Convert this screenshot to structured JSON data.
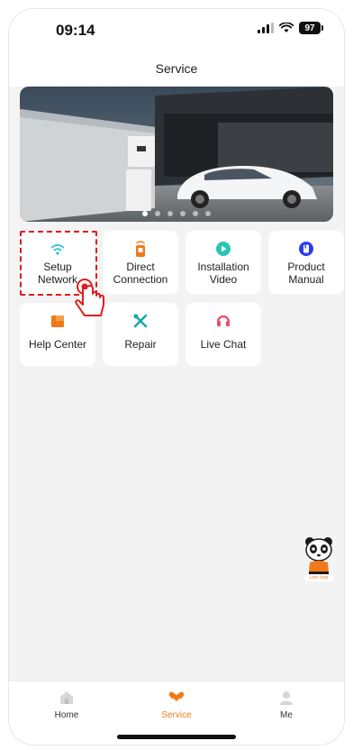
{
  "status_bar": {
    "time": "09:14",
    "battery": "97"
  },
  "header": {
    "title": "Service"
  },
  "banner": {
    "slide_count": 6,
    "active_index": 0
  },
  "services": [
    {
      "label": "Setup\nNetwork",
      "icon": "wifi-icon",
      "color": "#1fc1c9"
    },
    {
      "label": "Direct\nConnection",
      "icon": "direct-connection-icon",
      "color": "#f07a1a"
    },
    {
      "label": "Installation\nVideo",
      "icon": "play-icon",
      "color": "#2cc5b4"
    },
    {
      "label": "Product\nManual",
      "icon": "manual-icon",
      "color": "#2b3cf0"
    },
    {
      "label": "Help Center",
      "icon": "help-center-icon",
      "color": "#f07a1a"
    },
    {
      "label": "Repair",
      "icon": "repair-icon",
      "color": "#17a8a8"
    },
    {
      "label": "Live Chat",
      "icon": "headset-icon",
      "color": "#f2456a"
    }
  ],
  "mascot": {
    "badge": "Live chat"
  },
  "tabbar": {
    "tabs": [
      {
        "label": "Home",
        "icon": "home-icon",
        "active": false
      },
      {
        "label": "Service",
        "icon": "service-icon",
        "active": true
      },
      {
        "label": "Me",
        "icon": "user-icon",
        "active": false
      }
    ],
    "active_color": "#f07a1a"
  }
}
